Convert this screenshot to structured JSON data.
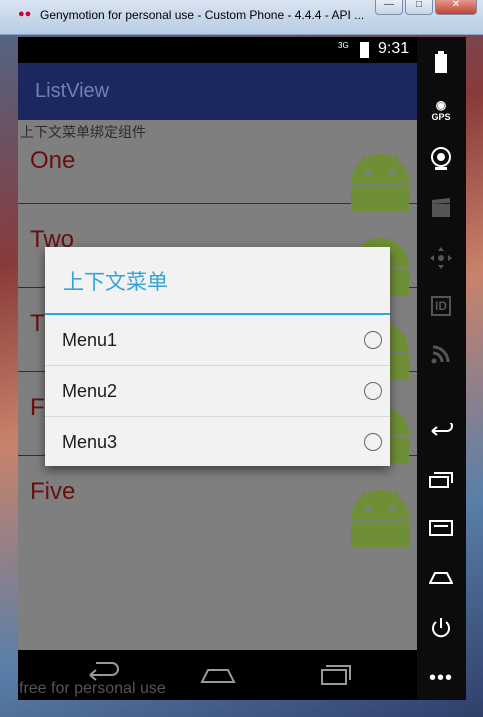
{
  "window": {
    "title": "Genymotion for personal use - Custom Phone - 4.4.4 - API ..."
  },
  "statusbar": {
    "network": "3G",
    "time": "9:31"
  },
  "app": {
    "title": "ListView",
    "hint": "上下文菜单绑定组件",
    "items": [
      "One",
      "Two",
      "Three",
      "Four",
      "Five"
    ]
  },
  "dialog": {
    "title": "上下文菜单",
    "menu": [
      "Menu1",
      "Menu2",
      "Menu3"
    ]
  },
  "sidebar": {
    "gps_label": "GPS",
    "id_label": "ID"
  },
  "watermark": "free for personal use",
  "colors": {
    "accent": "#32a5d6",
    "actionbar": "#1c2760",
    "list_text": "#6a0e0e",
    "android_green": "#7a9a3a"
  }
}
